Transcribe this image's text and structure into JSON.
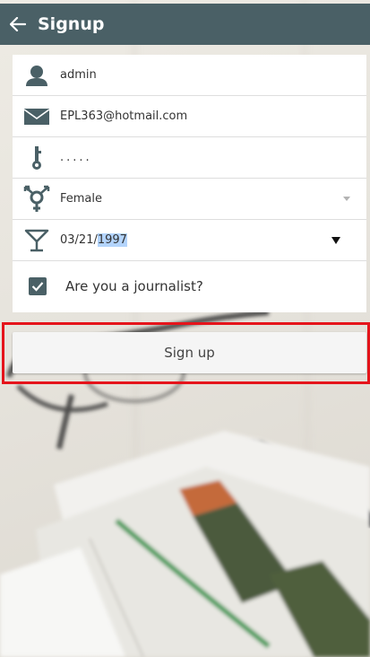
{
  "appbar": {
    "title": "Signup",
    "back_icon": "arrow-left-icon",
    "background": "#4a6066"
  },
  "form": {
    "username": {
      "icon": "user-icon",
      "value": "admin"
    },
    "email": {
      "icon": "envelope-icon",
      "value": "EPL363@hotmail.com"
    },
    "password": {
      "icon": "key-icon",
      "value": "....."
    },
    "gender": {
      "icon": "gender-icon",
      "value": "Female"
    },
    "birthdate": {
      "icon": "cocktail-glass-icon",
      "prefix": "03/21/",
      "selected": "1997"
    },
    "journalist": {
      "checked": true,
      "label": "Are you a journalist?"
    }
  },
  "signup_button": {
    "label": "Sign up"
  },
  "colors": {
    "accent": "#4a6066",
    "highlight_frame": "#e5141b",
    "text_selection": "#b3d4fc"
  }
}
